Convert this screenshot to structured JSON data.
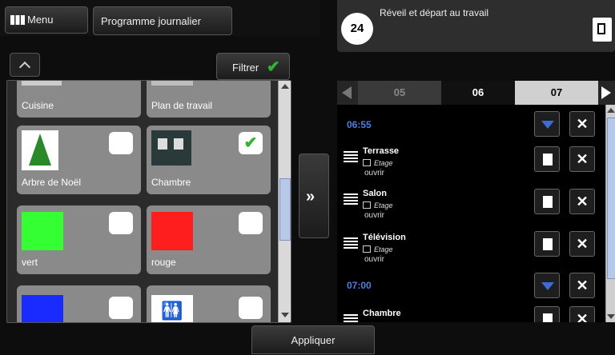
{
  "header": {
    "menu_label": "Menu",
    "programme_label": "Programme journalier",
    "badge": "24",
    "scenario_title": "Réveil et départ au travail"
  },
  "filter_label": "Filtrer",
  "tiles": [
    {
      "label": "Cuisine",
      "checked": false
    },
    {
      "label": "Plan de travail",
      "checked": false
    },
    {
      "label": "Arbre de Noël",
      "checked": false
    },
    {
      "label": "Chambre",
      "checked": true
    },
    {
      "label": "vert",
      "checked": false,
      "color": "#33ff33"
    },
    {
      "label": "rouge",
      "checked": false,
      "color": "#ff1e1e"
    },
    {
      "color": "#1a2bff"
    }
  ],
  "days": [
    "05",
    "06",
    "07"
  ],
  "schedule": {
    "time1": "06:55",
    "time2": "07:00",
    "items": [
      {
        "name": "Terrasse",
        "group": "Etage",
        "action": "ouvrir"
      },
      {
        "name": "Salon",
        "group": "Etage",
        "action": "ouvrir"
      },
      {
        "name": "Télévision",
        "group": "Etage",
        "action": "ouvrir"
      },
      {
        "name": "Chambre"
      }
    ]
  },
  "apply_label": "Appliquer",
  "colors": {
    "accent_blue": "#4f7ddf",
    "check_green": "#2fb52f"
  }
}
